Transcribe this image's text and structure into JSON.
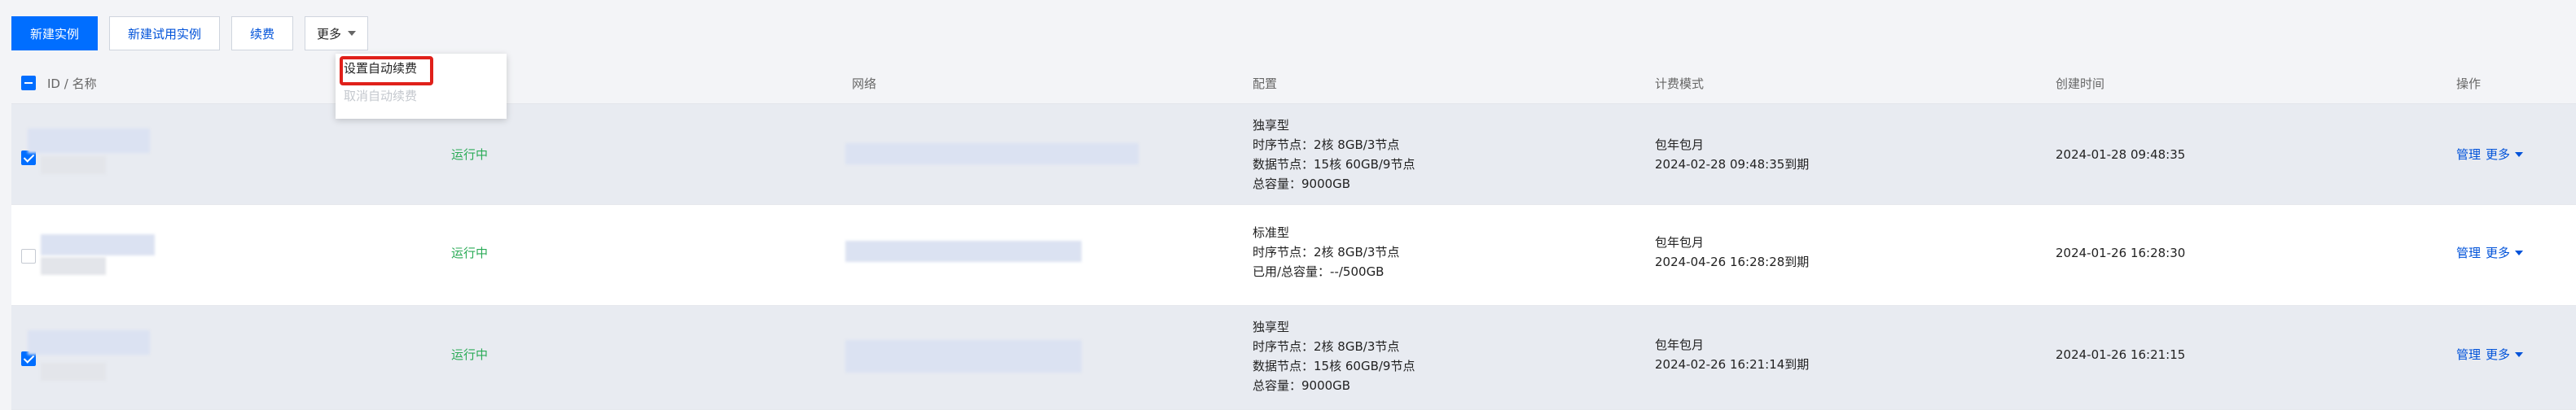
{
  "toolbar": {
    "new_instance": "新建实例",
    "new_trial_instance": "新建试用实例",
    "renew": "续费",
    "more": "更多"
  },
  "dropdown": {
    "items": [
      {
        "label": "设置自动续费",
        "state": "enabled"
      },
      {
        "label": "取消自动续费",
        "state": "disabled"
      }
    ]
  },
  "table": {
    "headers": {
      "id_name": "ID / 名称",
      "network": "网络",
      "config": "配置",
      "billing": "计费模式",
      "created": "创建时间",
      "actions": "操作"
    },
    "rows": [
      {
        "selected": true,
        "status": "运行中",
        "config": [
          "独享型",
          "时序节点：2核 8GB/3节点",
          "数据节点：15核 60GB/9节点",
          "总容量：9000GB"
        ],
        "billing": [
          "包年包月",
          "2024-02-28 09:48:35到期"
        ],
        "created": "2024-01-28 09:48:35",
        "manage": "管理",
        "more": "更多"
      },
      {
        "selected": false,
        "status": "运行中",
        "config": [
          "标准型",
          "时序节点：2核 8GB/3节点",
          "已用/总容量：--/500GB"
        ],
        "billing": [
          "包年包月",
          "2024-04-26 16:28:28到期"
        ],
        "created": "2024-01-26 16:28:30",
        "manage": "管理",
        "more": "更多"
      },
      {
        "selected": true,
        "status": "运行中",
        "config": [
          "独享型",
          "时序节点：2核 8GB/3节点",
          "数据节点：15核 60GB/9节点",
          "总容量：9000GB"
        ],
        "billing": [
          "包年包月",
          "2024-02-26 16:21:14到期"
        ],
        "created": "2024-01-26 16:21:15",
        "manage": "管理",
        "more": "更多"
      }
    ]
  },
  "colors": {
    "primary": "#006eff",
    "link": "#0052d9",
    "status_running": "#2bab57",
    "highlight": "#e0201a"
  }
}
